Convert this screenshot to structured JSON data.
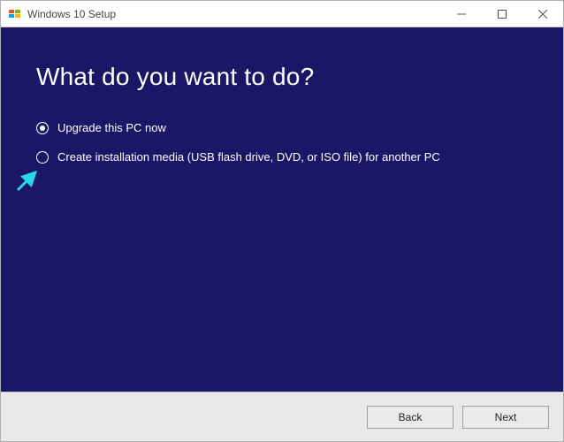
{
  "window": {
    "title": "Windows 10 Setup"
  },
  "page": {
    "heading": "What do you want to do?"
  },
  "options": {
    "upgrade": {
      "label": "Upgrade this PC now",
      "selected": true
    },
    "create_media": {
      "label": "Create installation media (USB flash drive, DVD, or ISO file) for another PC",
      "selected": false
    }
  },
  "footer": {
    "back_label": "Back",
    "next_label": "Next"
  }
}
